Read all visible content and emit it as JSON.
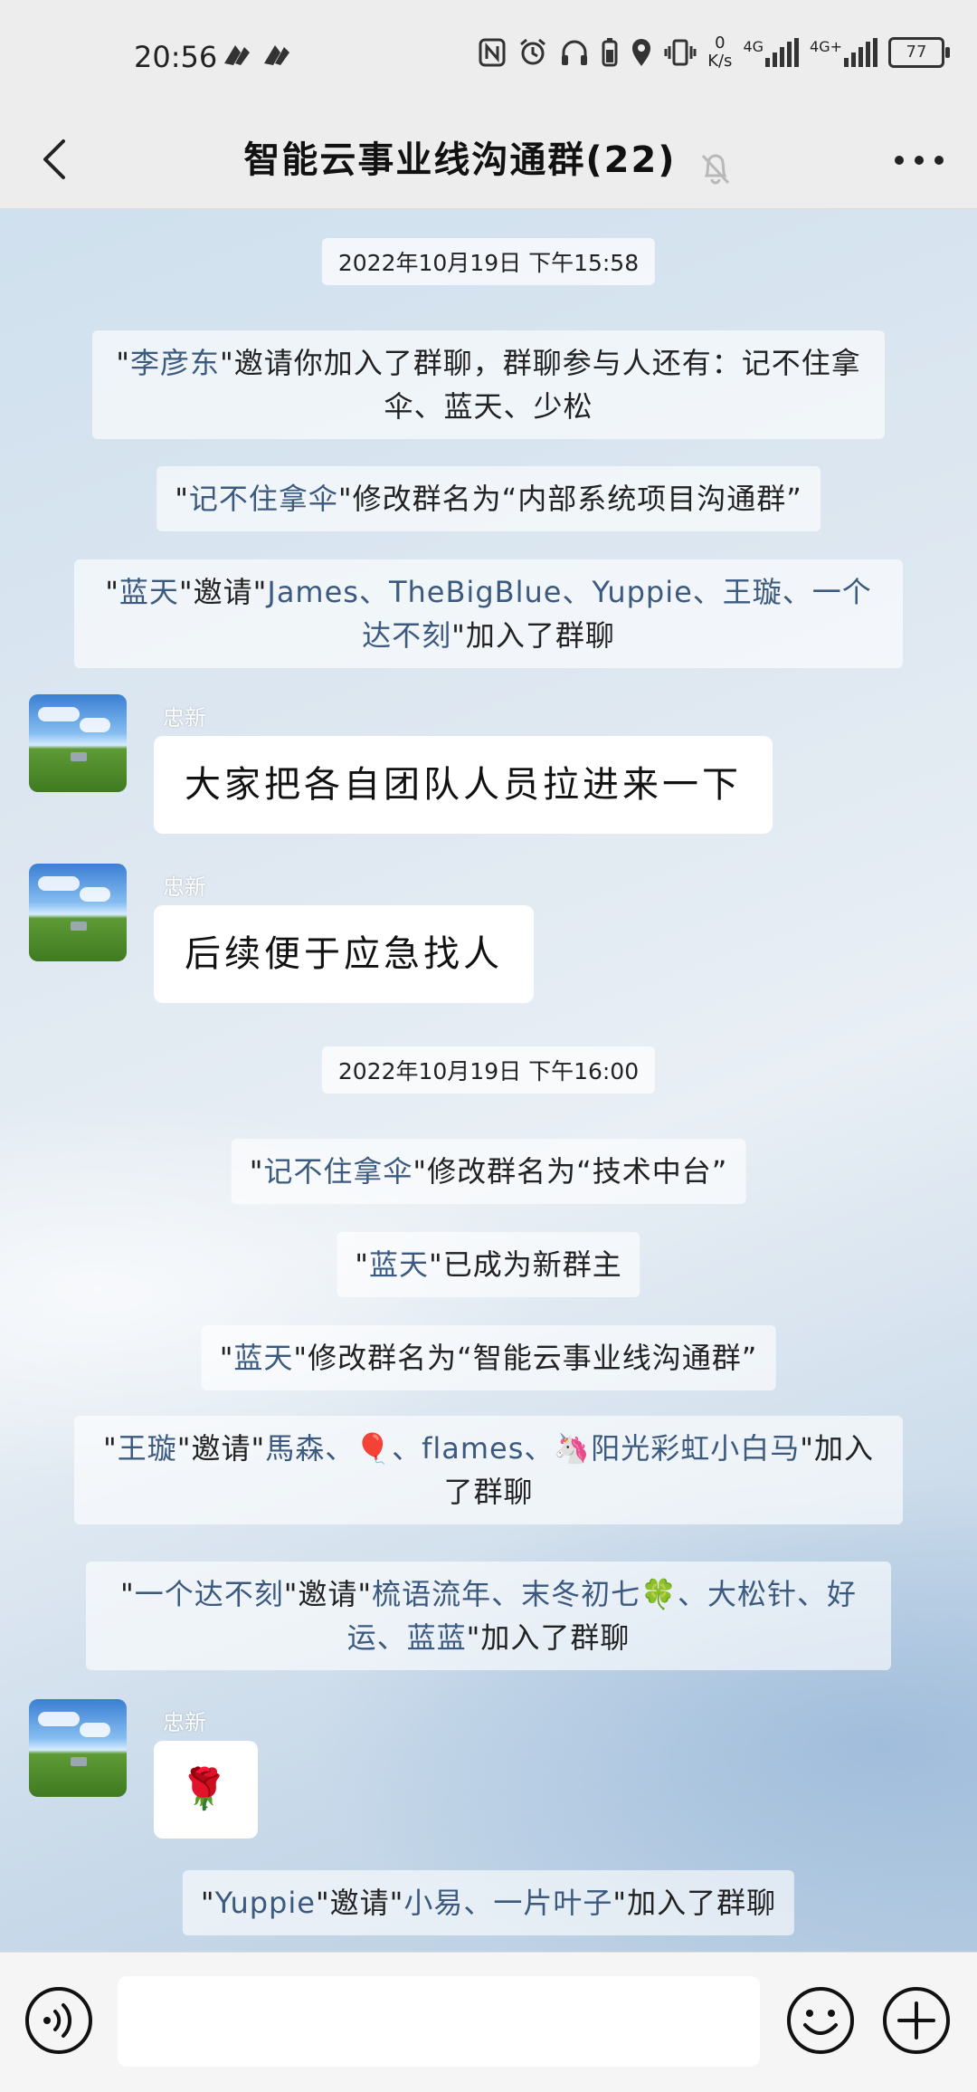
{
  "status_bar": {
    "time": "20:56",
    "net_speed_value": "0",
    "net_speed_unit": "K/s",
    "network_1": "4G",
    "network_2": "4G+",
    "battery": "77"
  },
  "header": {
    "title": "智能云事业线沟通群(22)",
    "back_icon": "chevron-left-icon",
    "mute_icon": "bell-off-icon",
    "more_icon": "more-icon"
  },
  "messages": {
    "ts1": "2022年10月19日 下午15:58",
    "sys1": {
      "q1": "\"",
      "name": "李彦东",
      "q2": "\"邀请你加入了群聊，群聊参与人还有：",
      "names": "记不住拿伞、蓝天、少松"
    },
    "sys2": {
      "q1": "\"",
      "name": "记不住拿伞",
      "text": "\"修改群名为“内部系统项目沟通群”"
    },
    "sys3": {
      "q1": "\"",
      "name": "蓝天",
      "q2": "\"邀请\"",
      "names": "James、TheBigBlue、Yuppie、王璇、一个达不刻",
      "q3": "\"加入了群聊"
    },
    "msg1": {
      "sender": "忠新",
      "text": "大家把各自团队人员拉进来一下"
    },
    "msg2": {
      "sender": "忠新",
      "text": "后续便于应急找人"
    },
    "ts2": "2022年10月19日 下午16:00",
    "sys4": {
      "q1": "\"",
      "name": "记不住拿伞",
      "text": "\"修改群名为“技术中台”"
    },
    "sys5": {
      "q1": "\"",
      "name": "蓝天",
      "text": "\"已成为新群主"
    },
    "sys6": {
      "q1": "\"",
      "name": "蓝天",
      "text": "\"修改群名为“智能云事业线沟通群”"
    },
    "sys7": {
      "q1": "\"",
      "name": "王璇",
      "q2": "\"邀请\"",
      "names": "馬森、🎈、flames、🦄阳光彩虹小白马",
      "q3": "\"加入了群聊"
    },
    "sys8": {
      "q1": "\"",
      "name": "一个达不刻",
      "q2": "\"邀请\"",
      "names": "梳语流年、末冬初七🍀、大松针、好运、蓝蓝",
      "q3": "\"加入了群聊"
    },
    "msg3": {
      "sender": "忠新",
      "emoji": "🌹"
    },
    "sys9": {
      "q1": "\"",
      "name": "Yuppie",
      "q2": "\"邀请\"",
      "names": "小易、一片叶子",
      "q3": "\"加入了群聊"
    }
  },
  "input_bar": {
    "voice_icon": "voice-icon",
    "input_value": "",
    "emoji_icon": "emoji-icon",
    "add_icon": "plus-icon"
  }
}
